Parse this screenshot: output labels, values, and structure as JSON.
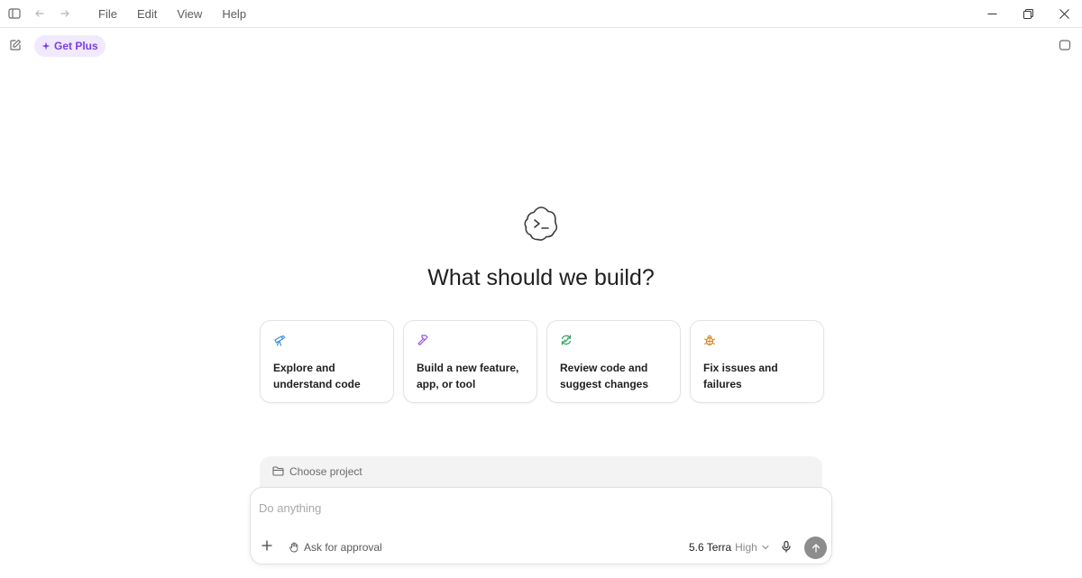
{
  "menu": {
    "file": "File",
    "edit": "Edit",
    "view": "View",
    "help": "Help"
  },
  "topbar": {
    "get_plus": "Get Plus"
  },
  "hero": {
    "title": "What should we build?"
  },
  "cards": [
    {
      "icon": "telescope-icon",
      "line1": "Explore and",
      "line2": "understand code"
    },
    {
      "icon": "hammer-icon",
      "line1": "Build a new feature,",
      "line2": "app, or tool"
    },
    {
      "icon": "review-icon",
      "line1": "Review code and",
      "line2": "suggest changes"
    },
    {
      "icon": "bug-icon",
      "line1": "",
      "line2": "Fix issues and failures"
    }
  ],
  "project": {
    "label": "Choose project"
  },
  "composer": {
    "placeholder": "Do anything",
    "approval": "Ask for approval",
    "model_name": "5.6 Terra",
    "model_effort": "High"
  },
  "colors": {
    "accent": "#7a3fe4",
    "accent_bg": "#f1e9fd",
    "send_bg": "#8c8c8c"
  }
}
